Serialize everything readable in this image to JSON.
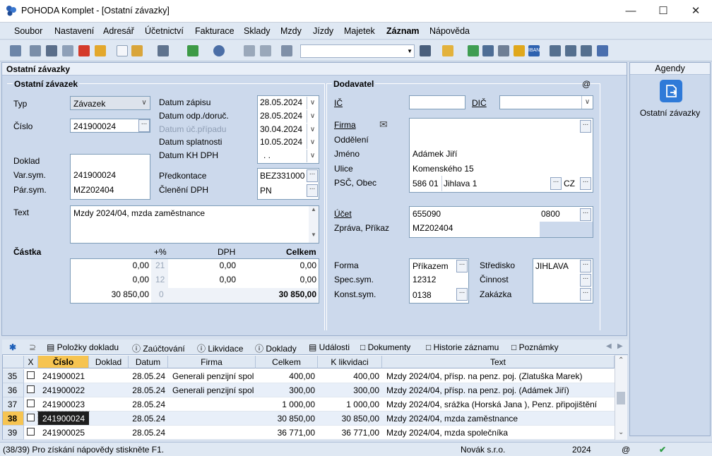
{
  "window": {
    "title": "POHODA Komplet - [Ostatní závazky]"
  },
  "menu": [
    "Soubor",
    "Nastavení",
    "Adresář",
    "Účetnictví",
    "Fakturace",
    "Sklady",
    "Mzdy",
    "Jízdy",
    "Majetek",
    "Záznam",
    "Nápověda"
  ],
  "panel_title": "Ostatní závazky",
  "left": {
    "heading": "Ostatní závazek",
    "typ_label": "Typ",
    "typ_value": "Závazek",
    "cislo_label": "Číslo",
    "cislo_value": "241900024",
    "doklad_label": "Doklad",
    "varsym_label": "Var.sym.",
    "varsym_value": "241900024",
    "parsym_label": "Pár.sym.",
    "parsym_value": "MZ202404",
    "text_label": "Text",
    "text_value": "Mzdy 2024/04, mzda zaměstnance"
  },
  "dates": {
    "zapis_label": "Datum zápisu",
    "zapis_value": "28.05.2024",
    "odp_label": "Datum odp./doruč.",
    "odp_value": "28.05.2024",
    "uc_label": "Datum úč.případu",
    "uc_value": "30.04.2024",
    "spl_label": "Datum splatnosti",
    "spl_value": "10.05.2024",
    "kh_label": "Datum KH DPH",
    "kh_value": ". .",
    "predk_label": "Předkontace",
    "predk_value": "BEZ331000",
    "cleneni_label": "Členění DPH",
    "cleneni_value": "PN"
  },
  "amounts": {
    "castka_label": "Částka",
    "pct_header": "+%",
    "dph_header": "DPH",
    "celkem_header": "Celkem",
    "rows": [
      {
        "base": "0,00",
        "pct": "21",
        "dph": "0,00",
        "total": "0,00"
      },
      {
        "base": "0,00",
        "pct": "12",
        "dph": "0,00",
        "total": "0,00"
      },
      {
        "base": "30 850,00",
        "pct": "0",
        "dph": "",
        "total": "30 850,00"
      }
    ]
  },
  "supplier": {
    "heading": "Dodavatel",
    "at": "@",
    "ic_label": "IČ",
    "ic_value": "",
    "dic_label": "DIČ",
    "dic_value": "",
    "firma_label": "Firma",
    "firma_value": "",
    "oddeleni_label": "Oddělení",
    "oddeleni_value": "",
    "jmeno_label": "Jméno",
    "jmeno_value": "Adámek Jiří",
    "ulice_label": "Ulice",
    "ulice_value": "Komenského 15",
    "psc_label": "PSČ, Obec",
    "psc_value": "586 01",
    "obec_value": "Jihlava 1",
    "country": "CZ",
    "ucet_label": "Účet",
    "ucet_value": "655090",
    "bank_value": "0800",
    "zprava_label": "Zpráva, Příkaz",
    "zprava_value": "MZ202404"
  },
  "payment": {
    "forma_label": "Forma",
    "forma_value": "Příkazem",
    "spec_label": "Spec.sym.",
    "spec_value": "12312",
    "konst_label": "Konst.sym.",
    "konst_value": "0138",
    "stredisko_label": "Středisko",
    "stredisko_value": "JIHLAVA",
    "cinnost_label": "Činnost",
    "zakazka_label": "Zakázka"
  },
  "agenda": {
    "header": "Agendy",
    "item": "Ostatní závazky"
  },
  "tabs": [
    "Položky dokladu",
    "Zaúčtování",
    "Likvidace",
    "Doklady",
    "Události",
    "Dokumenty",
    "Historie záznamu",
    "Poznámky"
  ],
  "grid": {
    "headers": [
      "X",
      "Číslo",
      "Doklad",
      "Datum",
      "Firma",
      "Celkem",
      "K likvidaci",
      "Text"
    ],
    "rows": [
      {
        "n": "35",
        "cislo": "241900021",
        "doklad": "",
        "datum": "28.05.24",
        "firma": "Generali penzijní spol",
        "celkem": "400,00",
        "lik": "400,00",
        "text": "Mzdy 2024/04, přísp. na penz. poj. (Zlatuška Marek)"
      },
      {
        "n": "36",
        "cislo": "241900022",
        "doklad": "",
        "datum": "28.05.24",
        "firma": "Generali penzijní spol",
        "celkem": "300,00",
        "lik": "300,00",
        "text": "Mzdy 2024/04, přísp. na penz. poj. (Adámek Jiří)"
      },
      {
        "n": "37",
        "cislo": "241900023",
        "doklad": "",
        "datum": "28.05.24",
        "firma": "",
        "celkem": "1 000,00",
        "lik": "1 000,00",
        "text": "Mzdy 2024/04, srážka (Horská Jana ), Penz. připojištění"
      },
      {
        "n": "38",
        "cislo": "241900024",
        "doklad": "",
        "datum": "28.05.24",
        "firma": "",
        "celkem": "30 850,00",
        "lik": "30 850,00",
        "text": "Mzdy 2024/04, mzda zaměstnance"
      },
      {
        "n": "39",
        "cislo": "241900025",
        "doklad": "",
        "datum": "28.05.24",
        "firma": "",
        "celkem": "36 771,00",
        "lik": "36 771,00",
        "text": "Mzdy 2024/04, mzda společníka"
      }
    ]
  },
  "status": {
    "help": "(38/39) Pro získání nápovědy stiskněte F1.",
    "company": "Novák s.r.o.",
    "year": "2024",
    "at": "@"
  }
}
